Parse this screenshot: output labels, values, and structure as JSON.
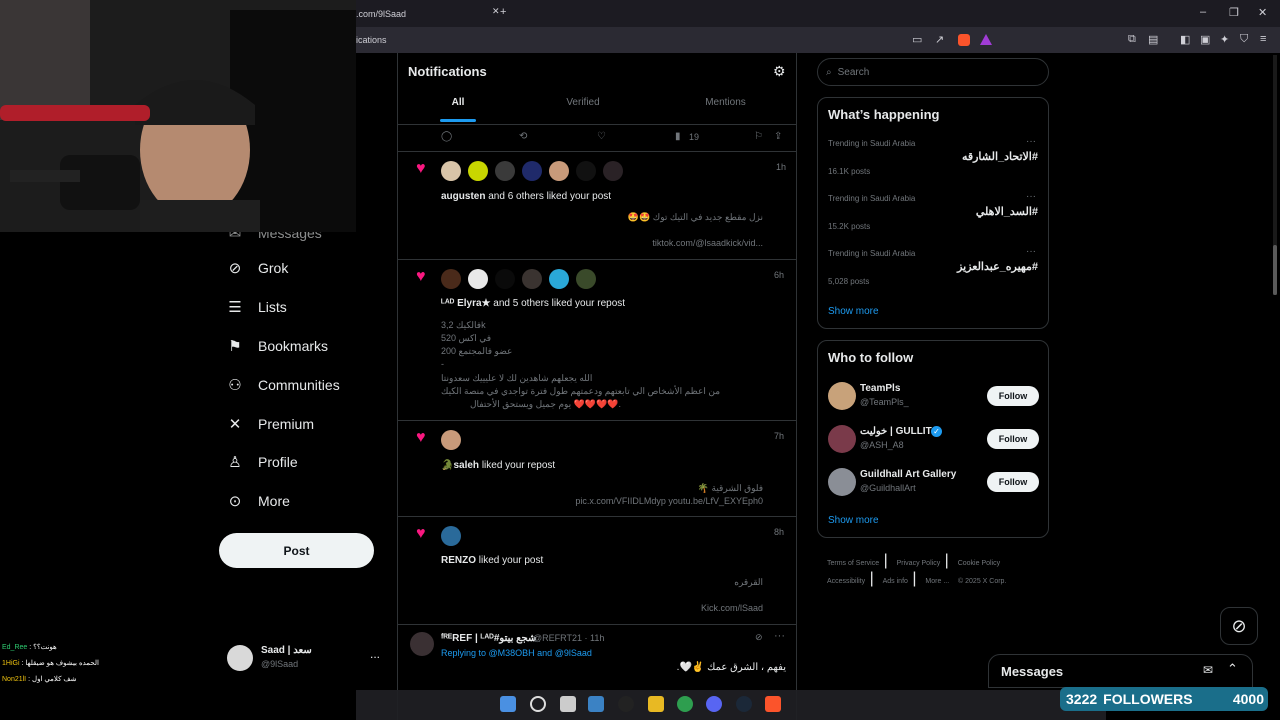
{
  "browser": {
    "tab_url": ".com/9lSaad",
    "new_tab_label": "+",
    "address_partial": "ications"
  },
  "nav": {
    "partial_item": "Messages",
    "items": [
      {
        "label": "Grok",
        "icon": "grok-icon",
        "glyph": "⊘"
      },
      {
        "label": "Lists",
        "icon": "lists-icon",
        "glyph": "☰"
      },
      {
        "label": "Bookmarks",
        "icon": "bookmark-icon",
        "glyph": "⚑"
      },
      {
        "label": "Communities",
        "icon": "communities-icon",
        "glyph": "⚇"
      },
      {
        "label": "Premium",
        "icon": "x-logo-icon",
        "glyph": "✕"
      },
      {
        "label": "Profile",
        "icon": "person-icon",
        "glyph": "♙"
      },
      {
        "label": "More",
        "icon": "more-circle-icon",
        "glyph": "⊙"
      }
    ],
    "post_label": "Post",
    "account": {
      "name": "Saad | سعد",
      "handle": "@9lSaad",
      "menu": "..."
    }
  },
  "main": {
    "title": "Notifications",
    "tabs": [
      {
        "label": "All",
        "active": true
      },
      {
        "label": "Verified",
        "active": false
      },
      {
        "label": "Mentions",
        "active": false
      }
    ],
    "top_actions": {
      "views": "19"
    },
    "notifications": [
      {
        "time": "1h",
        "actor": "augusten",
        "action": "and 6 others liked your post",
        "lines": [
          "نزل مقطع جديد في التيك توك 🤩🤩",
          "tiktok.com/@lsaadkick/vid..."
        ]
      },
      {
        "time": "6h",
        "actor": "ᴸᴬᴰ Elyra★",
        "action": "and 5 others liked your repost",
        "lines": [
          "فالكيك 3,2k",
          "في اكس 520",
          "عضو فالمجتمع 200",
          "-",
          "الله يجعلهم شاهدين لك لا عليييك سعدونتا",
          "من اعظم الأشخاص الي تابعتهم ودعمتهم طول فترة تواجدي في منصة الكيك",
          "يوم جميل ويستحق الأحتفال ❤️❤️❤️❤️."
        ]
      },
      {
        "time": "7h",
        "actor": "🐊saleh",
        "action": "liked your repost",
        "lines": [
          "فلوق الشرقية 🌴",
          "pic.x.com/VFIIDLMdyp youtu.be/LfV_EXYEph0"
        ]
      },
      {
        "time": "8h",
        "actor": "RENZO",
        "action": "liked your post",
        "lines": [
          "القرقره",
          "Kick.com/lSaad"
        ]
      }
    ],
    "reply": {
      "name": "ᶠᴿᴱREF | ᴸᴬᴰ#شجع بيتو",
      "meta": "@REFRT21 · 11h",
      "replying": "Replying to @M38OBH and @9lSaad",
      "text": "يفهم ، الشرق عمك ✌️🤍."
    }
  },
  "right": {
    "search_placeholder": "Search",
    "happening_title": "What’s happening",
    "trends": [
      {
        "meta": "Trending in Saudi Arabia",
        "tag": "#الاتحاد_الشارقه",
        "count": "16.1K posts"
      },
      {
        "meta": "Trending in Saudi Arabia",
        "tag": "#السد_الاهلي",
        "count": "15.2K posts"
      },
      {
        "meta": "Trending in Saudi Arabia",
        "tag": "#مهيره_عبدالعزيز",
        "count": "5,028 posts"
      }
    ],
    "show_more": "Show more",
    "wtf_title": "Who to follow",
    "follow_label": "Follow",
    "wtf": [
      {
        "name": "TeamPls",
        "handle": "@TeamPls_",
        "color": "#c8a27a"
      },
      {
        "name": "خوليت | GULLIT",
        "handle": "@ASH_A8",
        "color": "#7a3a4a"
      },
      {
        "name": "Guildhall Art Gallery",
        "handle": "@GuildhallArt",
        "color": "#8a8e96"
      }
    ],
    "footer": [
      "Terms of Service",
      "Privacy Policy",
      "Cookie Policy",
      "Accessibility",
      "Ads info",
      "More ...",
      "© 2025 X Corp."
    ]
  },
  "overlay": {
    "messages_label": "Messages",
    "followers_count": "3222",
    "followers_label": "FOLLOWERS",
    "followers_goal": "4000"
  },
  "chat": [
    {
      "user": "Ed_Ree",
      "msg": "هونت؟؟"
    },
    {
      "user": "1HiGi",
      "msg": "الحمده بيشوف هو ضيقلها"
    },
    {
      "user": "Non21lI",
      "msg": "شف كلامي اول"
    }
  ],
  "colors": {
    "accent": "#1d9bf0",
    "like": "#f91880",
    "followers_bg": "#1a6e8a"
  }
}
